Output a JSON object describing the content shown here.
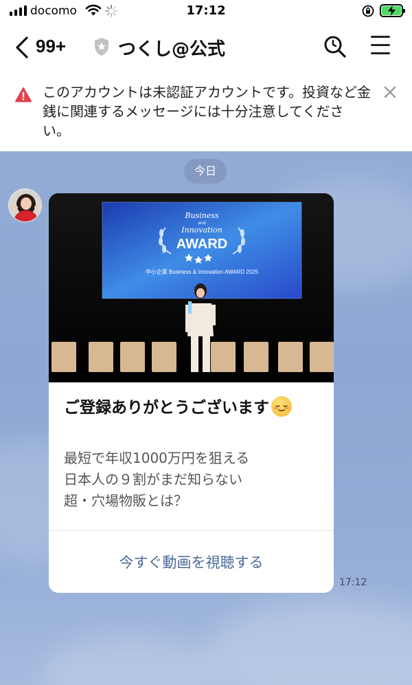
{
  "status_bar": {
    "carrier": "docomo",
    "time": "17:12",
    "battery_color": "#4cd964"
  },
  "header": {
    "unread_count": "99+",
    "account_name": "つくし@公式",
    "icons": [
      "back-chevron-icon",
      "shield-icon",
      "search-icon",
      "menu-icon"
    ]
  },
  "warning": {
    "text": "このアカウントは未認証アカウントです。投資など金銭に関連するメッセージには十分注意してください。",
    "icon": "warning-triangle-icon",
    "icon_color": "#e0414a"
  },
  "chat": {
    "date_label": "今日",
    "message": {
      "image": {
        "logo_line1": "Business",
        "logo_line2": "and",
        "logo_line3": "Innovation",
        "logo_main": "AWARD",
        "screen_caption": "中小企業 Business & Innovation AWARD 2025"
      },
      "title": "ご登録ありがとうございます",
      "body_lines": [
        "最短で年収1000万円を狙える",
        "日本人の９割がまだ知らない",
        "超・穴場物販とは？"
      ],
      "cta_label": "今すぐ動画を視聴する",
      "cta_color": "#4a6a9a",
      "time": "17:12"
    }
  }
}
